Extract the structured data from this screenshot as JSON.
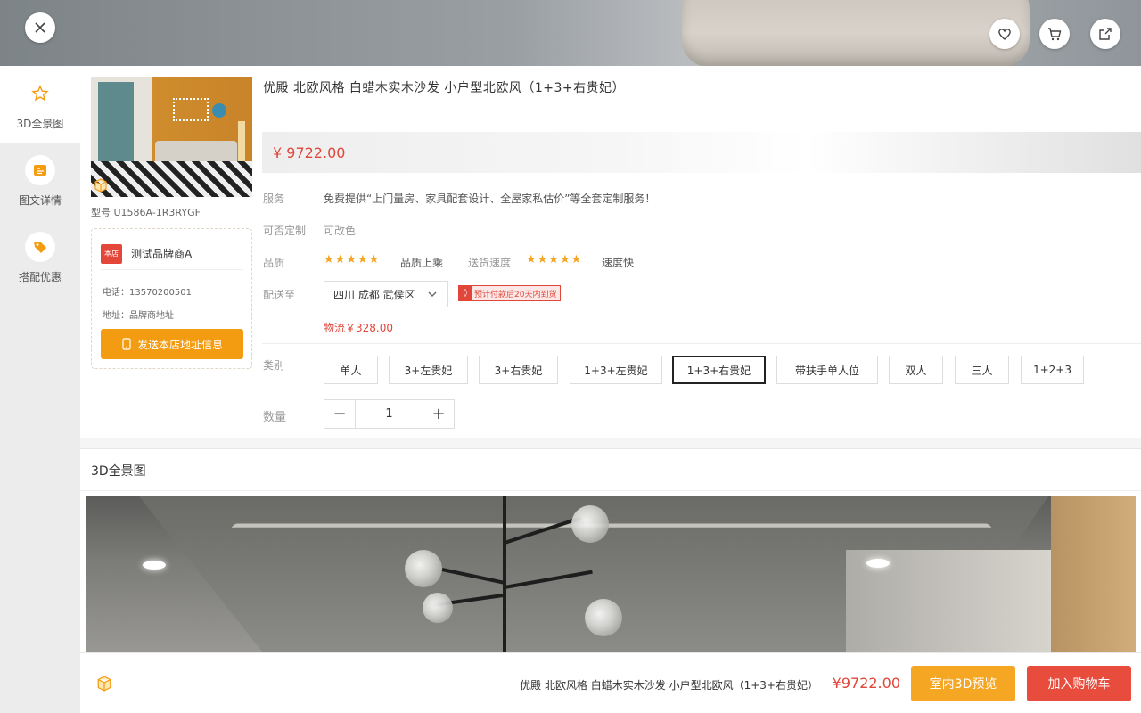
{
  "header": {
    "icons": [
      "close-icon",
      "heart-icon",
      "cart-icon",
      "share-icon"
    ]
  },
  "sidebar": {
    "items": [
      {
        "label": "3D全景图",
        "icon": "star-icon"
      },
      {
        "label": "图文详情",
        "icon": "image-text-icon"
      },
      {
        "label": "搭配优惠",
        "icon": "tag-icon"
      }
    ]
  },
  "product": {
    "title": "优殿  北欧风格  白蜡木实木沙发  小户型北欧风（1+3+右贵妃）",
    "price": "¥ 9722.00",
    "model_no": "型号 U1586A-1R3RYGF",
    "service_label": "服务",
    "service_text": "免费提供“上门量房、家具配套设计、全屋家私估价”等全套定制服务！",
    "custom_label": "可否定制",
    "custom_text": "可改色",
    "quality_label": "品质",
    "quality_rating": 5,
    "quality_text": "品质上乘",
    "speed_label": "送货速度",
    "speed_rating": 5,
    "speed_text": "速度快",
    "ship_label": "配送至",
    "region": "四川 成都 武侯区",
    "delivery_tag": "预计付款后20天内到货",
    "freight": "物流￥328.00",
    "category_label": "类别",
    "categories": [
      "单人",
      "3+左贵妃",
      "3+右贵妃",
      "1+3+左贵妃",
      "1+3+右贵妃",
      "带扶手单人位",
      "双人",
      "三人",
      "1+2+3"
    ],
    "selected_category": "1+3+右贵妃",
    "quantity_label": "数量",
    "quantity": "1"
  },
  "brand": {
    "tag": "本店",
    "name": "测试品牌商A",
    "phone": "电话：13570200501",
    "address": "地址：品牌商地址",
    "send_button": "发送本店地址信息"
  },
  "section": {
    "title": "3D全景图"
  },
  "bottom": {
    "title": "优殿  北欧风格  白蜡木实木沙发  小户型北欧风（1+3+右贵妃）",
    "price": "¥9722.00",
    "preview_button": "室内3D预览",
    "cart_button": "加入购物车"
  },
  "colors": {
    "accent_orange": "#f39c12",
    "cart_red": "#e74c3c",
    "price_red": "#e0463a",
    "star_gold": "#f4a623"
  }
}
